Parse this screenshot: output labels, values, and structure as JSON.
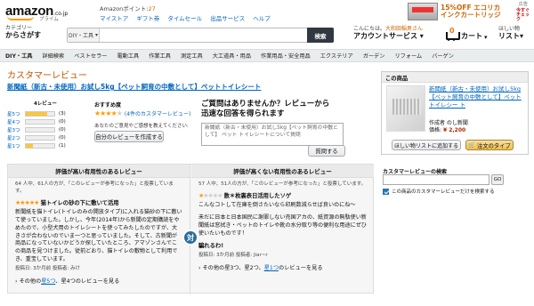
{
  "header": {
    "logo": {
      "brand": "amazon",
      "tld": ".co.jp",
      "sub": "プライム"
    },
    "points_label": "Amazonポイント:",
    "points_value": "27",
    "links": [
      "マイストア",
      "ギフト券",
      "タイムセール",
      "出品サービス",
      "ヘルプ"
    ],
    "promo": {
      "line1": "15%OFF エコリカ",
      "line2": "インクカートリッジ"
    },
    "ad_tag": "広告",
    "ad_tag2": "今すぐチェック"
  },
  "search": {
    "category_label": "カテゴリー",
    "category_value": "からさがす",
    "scope": "DIY・工具",
    "button": "検索"
  },
  "account": {
    "greeting": "こんにちは。",
    "name": "大和田稲男さん",
    "label": "アカウントサービス"
  },
  "cart": {
    "count": "0",
    "label": "カート"
  },
  "wishlist": {
    "line1": "ほしい物",
    "line2": "リスト"
  },
  "nav": [
    "DIY・工具",
    "詳細検索",
    "ベストセラー",
    "電動工具",
    "作業工具",
    "測定工具",
    "大工道具・用品",
    "作業用品・安全用品",
    "エクステリア",
    "ガーデン",
    "リフォーム",
    "バーゲン"
  ],
  "main": {
    "heading": "カスタマーレビュー",
    "product_title": "新聞紙（新古・未使用）お試し5kg【ペット飼育の中敷として】ペットトイレシート",
    "histogram": {
      "caption": "4レビュー",
      "rows": [
        {
          "label": "星5つ",
          "count": "(3)",
          "fraction": 0.75
        },
        {
          "label": "星4つ",
          "count": "(0)",
          "fraction": 0
        },
        {
          "label": "星3つ",
          "count": "(0)",
          "fraction": 0
        },
        {
          "label": "星2つ",
          "count": "(0)",
          "fraction": 0
        },
        {
          "label": "星1つ",
          "count": "(1)",
          "fraction": 0.25
        }
      ]
    },
    "average": {
      "label": "おすすめ度",
      "rating": 4,
      "text": "(4件のカスタマーレビュー)",
      "prompt": "あなたのご意見やご感想を教えてください:",
      "write_button": "自分のレビューを作成する"
    },
    "question": {
      "heading_line1": "ご質問はありませんか？レビューから",
      "heading_line2": "迅速な回答を得られます",
      "placeholder": "新聞紙（新古・未使用）お試し5kg【ペット飼育の中敷として】 ペット トイレシートについて質問",
      "button": "質問する"
    }
  },
  "compare": {
    "left": {
      "header": "評価が高い有用性のあるレビュー",
      "helpful": "64 人中、61人の方が、「このレビューが参考になった」と投票しています。",
      "rating": 5,
      "title": "猫トイレの砂の下に敷いて活用",
      "text": "新聞紙を猫トイレ(トイレのみの開放タイプ)に入れる猫砂の下に敷いて使っていました。しかし、今年(2014年)から新聞の定期購読をやめたので、小型犬用のトイレシートを使ってみたしたのですが、大きさが合わないのでいま一つと思っていました。そして、古新聞が商品になっていないかどうか探していたところ、アマゾンさんでこの商品を見つけました。従前どおり、猫トイレの敷物として利用でき、重宝しています。",
      "poster": "投稿日: 3か月前 投稿者: みけ",
      "more_prefix": "› その他の",
      "more_link1": "星5つ",
      "more_mid": "、星4つのレビューを見る"
    },
    "right": {
      "header": "評価が高くない有用性のあるレビュー",
      "helpful": "57 人中、51人の方が、「このレビューが参考になった」と投票しています。",
      "rating": 1,
      "title": "数＊枚裏表日活用したソゲ",
      "text": "こんなコトして在庫を倒さたいなら印刷数減らせば良いのにね～",
      "text2": "未だに日本と日本国民に謝罪しない売国アカの、紙資源の無駄使い新聞紙は窓拭き・ペットのトイレや靴の水分取り等の便利な用途にぜひ使いたいものです！",
      "closing": "騙れるわ!",
      "poster": "投稿日: 3か月前 投稿者: Jiar~r",
      "more_prefix": "› その他の星3つ、星2つ、",
      "more_link1": "星1つ",
      "more_mid": "のレビューを見る"
    },
    "vs_label": "対"
  },
  "sidebar": {
    "box_head": "この商品",
    "title": "新聞紙（新古・未使用）お試し5kg【ペット飼育の中敷として】ペットトイレシー ト",
    "author": "作成者 のし新聞",
    "price_label": "価格:",
    "price": "¥ 2,200",
    "wish_button": "ほしい物リストに追加する",
    "order_button": "注文のタイプ",
    "search_label": "カスタマーレビューの検索",
    "search_go": "GO",
    "checkbox_label": "この商品のカスタマーレビューだけを検索する"
  },
  "colors": {
    "accent": "#c45500",
    "link": "#0066c0",
    "star": "#ff9900",
    "nav_bg": "#eaeded"
  }
}
